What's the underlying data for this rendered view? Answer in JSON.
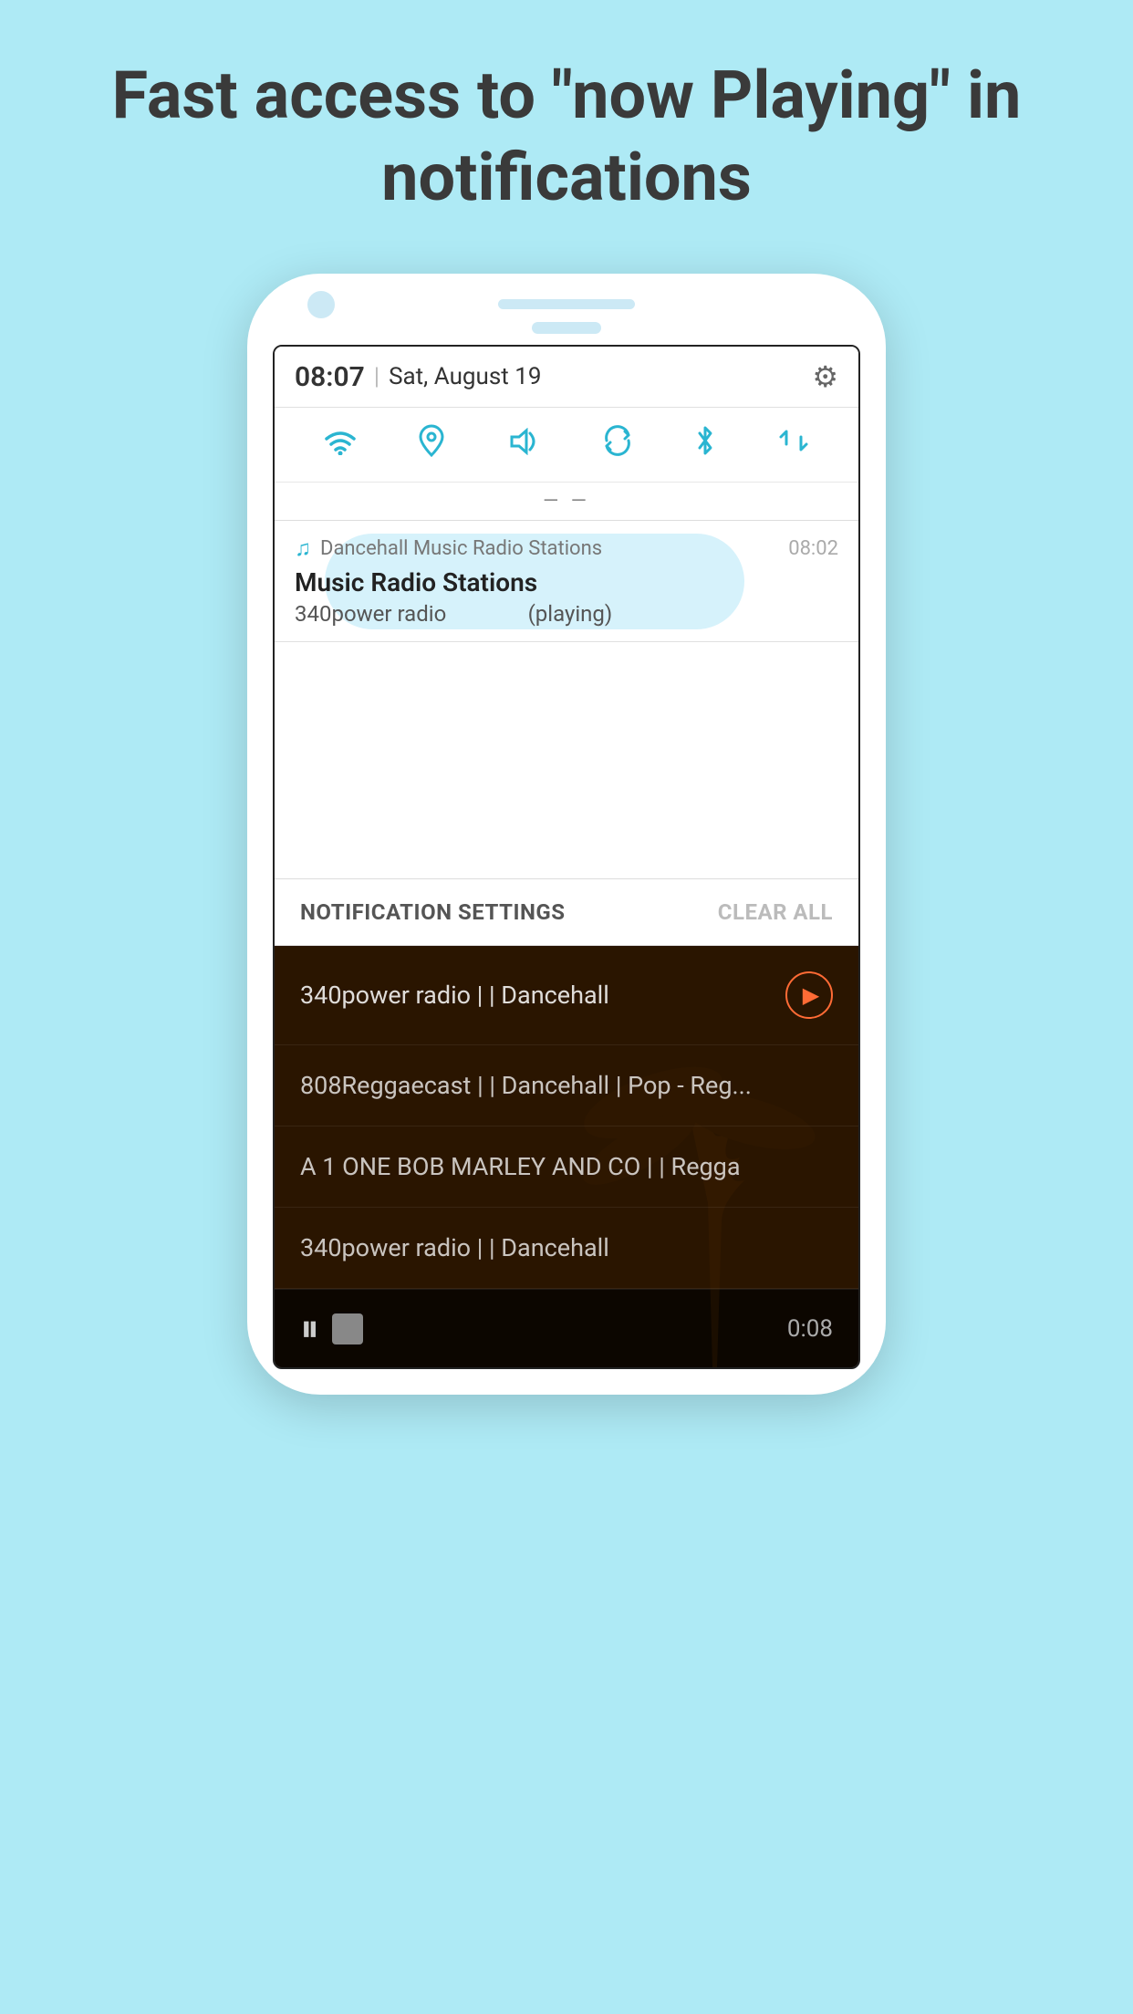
{
  "page": {
    "bg_color": "#aeeaf5"
  },
  "header": {
    "title": "Fast access to \"now Playing\" in notifications"
  },
  "phone": {
    "status_bar": {
      "time": "08:07",
      "divider": "|",
      "date": "Sat, August 19"
    },
    "quick_settings": {
      "icons": [
        "wifi",
        "location",
        "volume",
        "sync",
        "bluetooth",
        "data-transfer"
      ]
    },
    "drag_handle": "≡",
    "notification": {
      "icon": "♫",
      "app_name": "Dancehall Music Radio Stations",
      "time": "08:02",
      "title": "Music Radio Stations",
      "station": "340power radio",
      "status": "(playing)"
    },
    "bottom_bar": {
      "settings_label": "NOTIFICATION SETTINGS",
      "clear_label": "CLEAR ALL"
    },
    "app_list": [
      {
        "text": "340power radio | | Dancehall",
        "has_play": true
      },
      {
        "text": "808Reggaecast | | Dancehall | Pop - Reg...",
        "has_play": false
      },
      {
        "text": "A 1 ONE BOB MARLEY AND CO | | Regga",
        "has_play": false
      },
      {
        "text": "340power radio | | Dancehall",
        "has_play": false
      }
    ],
    "player": {
      "time": "0:08"
    }
  }
}
